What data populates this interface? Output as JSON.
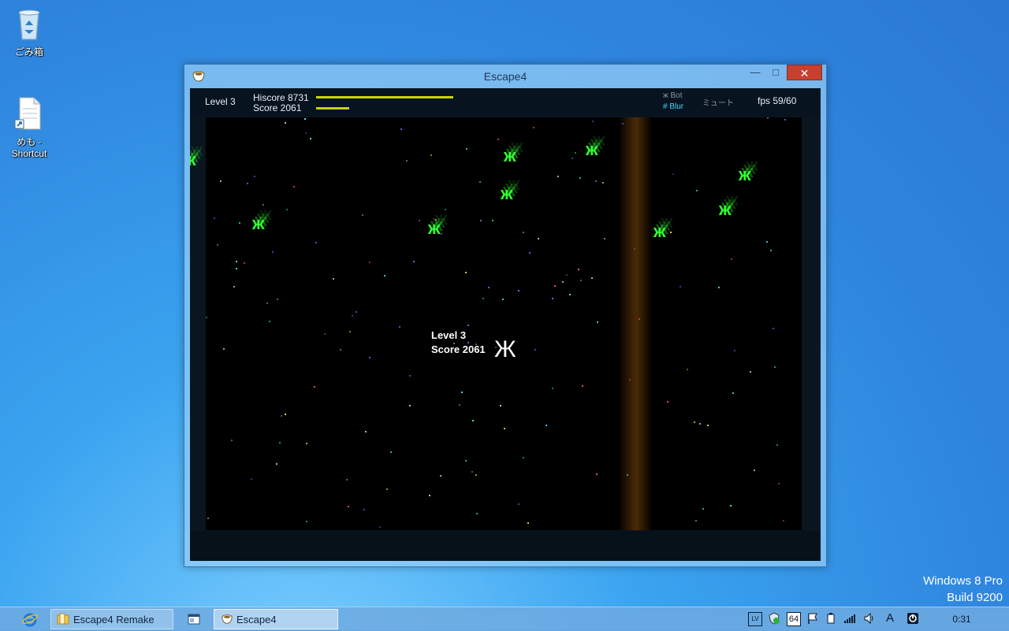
{
  "desktop": {
    "icons": [
      {
        "label": "ごみ箱",
        "icon": "recycle-bin-icon"
      },
      {
        "label": "めも - Shortcut",
        "icon": "text-document-shortcut-icon"
      }
    ],
    "watermark": {
      "line1": "Windows 8 Pro",
      "line2": "Build 9200"
    }
  },
  "window": {
    "title": "Escape4",
    "minimize_glyph": "—",
    "maximize_glyph": "□",
    "close_glyph": "✕"
  },
  "game": {
    "hud": {
      "level": "Level 3",
      "hiscore": "Hiscore 8731",
      "score": "Score 2061",
      "hiscore_fraction": 1.0,
      "score_fraction": 0.24,
      "bot_option": "ж Bot",
      "blur_option": "# Blur",
      "mute_option": "ミュート",
      "fps": "fps 59/60"
    },
    "center_text": {
      "level": "Level 3",
      "score": "Score 2061"
    },
    "enemy_glyph": "ж",
    "player_glyph": "Ж",
    "colors": {
      "enemy": "#2fff2f",
      "bar": "#c8d400",
      "blur_on": "#3fd9ff",
      "bot_off": "#8a96a3"
    }
  },
  "taskbar": {
    "buttons": [
      {
        "label": "",
        "icon": "internet-explorer-icon"
      },
      {
        "label": "Escape4 Remake",
        "icon": "folder-icon"
      },
      {
        "label": "",
        "icon": "window-icon"
      },
      {
        "label": "Escape4",
        "icon": "app-cup-icon"
      }
    ],
    "tray": {
      "ime_badge": "64",
      "ime_mode": "A",
      "time": "0:31"
    }
  }
}
